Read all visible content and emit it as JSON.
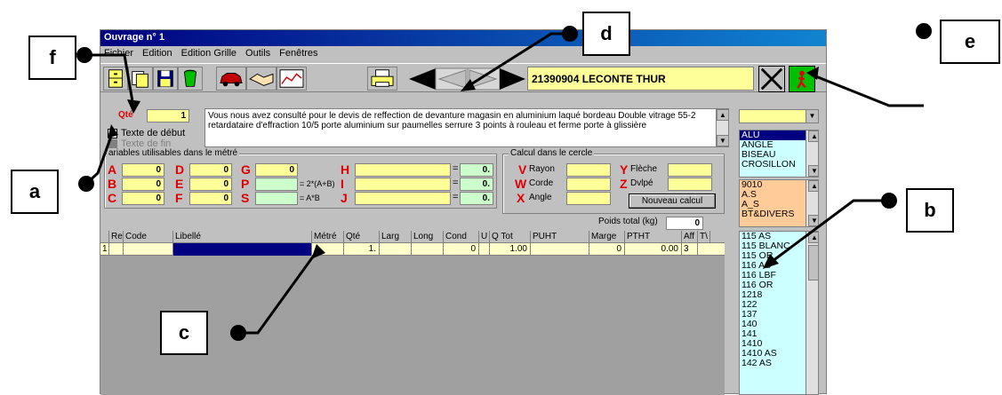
{
  "window": {
    "title": "Ouvrage n° 1"
  },
  "menu": [
    "Fichier",
    "Edition",
    "Edition Grille",
    "Outils",
    "Fenêtres"
  ],
  "toolbar": {
    "client": "21390904 LECONTE THUR"
  },
  "qte": {
    "label": "Qté",
    "value": "1"
  },
  "checkboxes": {
    "debut": "Texte de début",
    "fin": "Texte de fin"
  },
  "description": "Vous nous avez consulté pour le devis de reffection de devanture magasin en aluminium laqué bordeau Double vitrage 55-2 retardataire d'effraction 10/5 porte aluminium sur paumelles serrure 3 points à rouleau et ferme porte à glissière",
  "variables": {
    "title": "ariables utilisables dans le métré",
    "rows": [
      {
        "letters": [
          "A",
          "D",
          "G",
          "H"
        ],
        "values": [
          "0",
          "0",
          "0",
          "",
          "0."
        ]
      },
      {
        "letters": [
          "B",
          "E",
          "P",
          "I"
        ],
        "values": [
          "0",
          "0",
          "",
          "",
          "0."
        ],
        "formula": "= 2*(A+B)"
      },
      {
        "letters": [
          "C",
          "F",
          "S",
          "J"
        ],
        "values": [
          "0",
          "0",
          "",
          "",
          "0."
        ],
        "formula": "= A*B"
      }
    ]
  },
  "cercle": {
    "title": "Calcul dans le cercle",
    "items": [
      {
        "letter": "V",
        "label": "Rayon"
      },
      {
        "letter": "W",
        "label": "Corde"
      },
      {
        "letter": "X",
        "label": "Angle"
      },
      {
        "letter": "Y",
        "label": "Flèche"
      },
      {
        "letter": "Z",
        "label": "Dvlpé"
      }
    ],
    "button": "Nouveau calcul"
  },
  "poids": {
    "label": "Poids total (kg)",
    "value": "0"
  },
  "grid": {
    "headers": [
      "Re",
      "Code",
      "Libellé",
      "Métré",
      "Qté",
      "Larg",
      "Long",
      "Cond",
      "U",
      "Q Tot",
      "PUHT",
      "Marge",
      "PTHT",
      "Aff",
      "T\\"
    ],
    "row": [
      "1",
      "",
      "",
      "",
      "",
      "1.",
      "",
      "",
      "0",
      "",
      "1.00",
      "",
      "0",
      "0.00",
      "3"
    ]
  },
  "lists": {
    "list1": [
      "ALU",
      "ANGLE",
      "BISEAU",
      "CROSILLON"
    ],
    "list2": [
      "9010",
      "A.S",
      "A_S",
      "BT&DIVERS"
    ],
    "list3": [
      "115 AS",
      "115 BLANC",
      "115 OR",
      "116 AS",
      "116 LBF",
      "116 OR",
      "1218",
      "122",
      "137",
      "140",
      "141",
      "1410",
      "1410 AS",
      "142 AS"
    ]
  },
  "callouts": [
    "a",
    "b",
    "c",
    "d",
    "e",
    "f"
  ]
}
